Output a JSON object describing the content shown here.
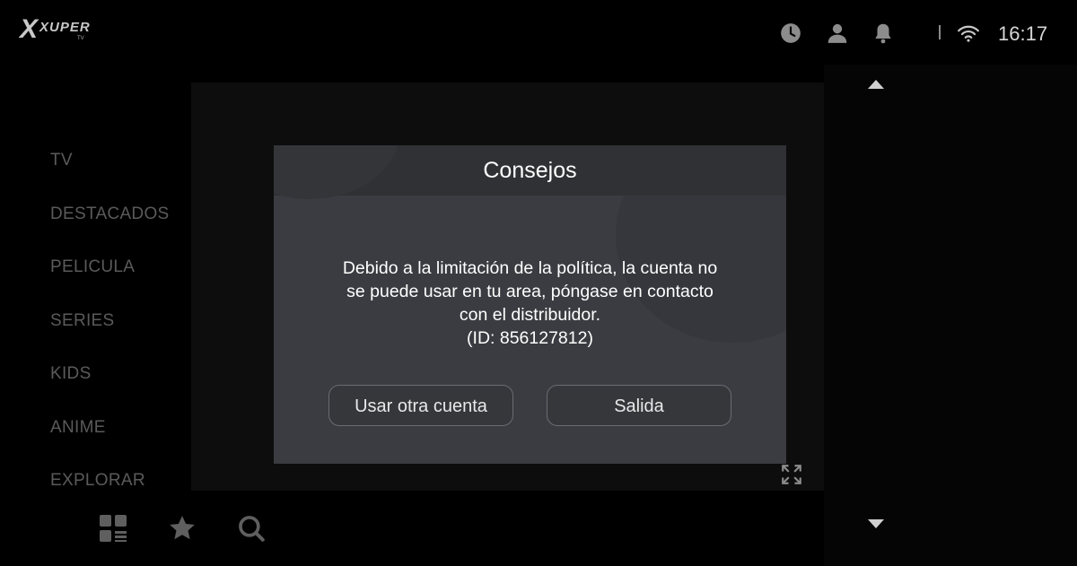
{
  "app": {
    "logo_text": "XUPER",
    "logo_sub": "TV"
  },
  "status_bar": {
    "icons": [
      "history-icon",
      "profile-icon",
      "notification-icon",
      "wifi-icon"
    ],
    "time": "16:17"
  },
  "nav": {
    "items": [
      {
        "label": "TV"
      },
      {
        "label": "DESTACADOS"
      },
      {
        "label": "PELICULA"
      },
      {
        "label": "SERIES"
      },
      {
        "label": "KIDS"
      },
      {
        "label": "ANIME"
      },
      {
        "label": "EXPLORAR"
      }
    ]
  },
  "bottom_bar": {
    "icons": [
      "grid-menu-icon",
      "favorites-star-icon",
      "search-icon"
    ]
  },
  "dialog": {
    "title": "Consejos",
    "message_lines": [
      "Debido a la limitación de la política, la cuenta no",
      "se puede usar en tu area, póngase en contacto",
      "con el distribuidor.",
      "(ID: 856127812)"
    ],
    "buttons": {
      "other_account": "Usar otra cuenta",
      "exit": "Salida"
    }
  },
  "colors": {
    "background": "#000000",
    "dialog_bg": "#3a3c41",
    "nav_text": "#5a5a5a"
  }
}
